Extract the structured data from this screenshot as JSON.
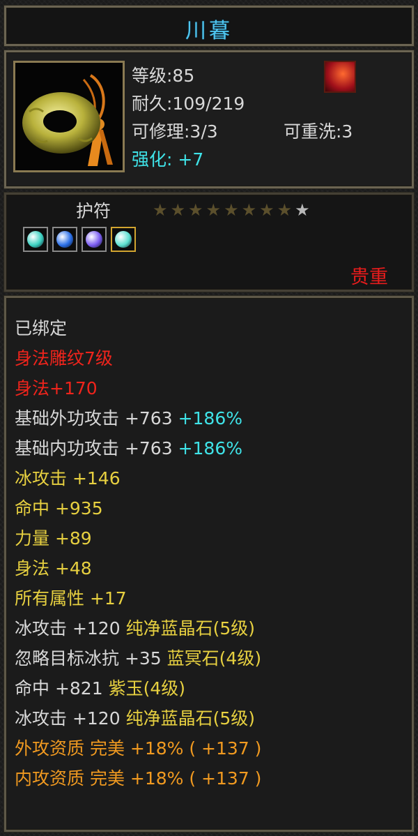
{
  "item": {
    "name": "川暮",
    "level_label": "等级:85",
    "durability_label": "耐久:109/219",
    "repair_label": "可修理:3/3",
    "rewash_label": "可重洗:3",
    "enhance_label": "强化:",
    "enhance_value": "+7",
    "type_label": "护符",
    "rarity_label": "贵重",
    "stars_total": 9,
    "stars_filled": 8,
    "gems": [
      {
        "icon": "teal-gem-icon",
        "color": "#3bd0c0"
      },
      {
        "icon": "blue-gem-icon",
        "color": "#2a6fe8"
      },
      {
        "icon": "purple-gem-icon",
        "color": "#7a5cf0"
      },
      {
        "icon": "teal-gem-icon",
        "color": "#5ce0d0"
      }
    ]
  },
  "attributes": [
    {
      "parts": [
        {
          "text": "已绑定",
          "color": "white"
        }
      ]
    },
    {
      "parts": [
        {
          "text": "身法雕纹7级",
          "color": "red"
        }
      ]
    },
    {
      "parts": [
        {
          "text": "身法+170",
          "color": "red"
        }
      ]
    },
    {
      "parts": [
        {
          "text": "基础外功攻击  +763 ",
          "color": "white"
        },
        {
          "text": "+186%",
          "color": "cyan"
        }
      ]
    },
    {
      "parts": [
        {
          "text": "基础内功攻击  +763 ",
          "color": "white"
        },
        {
          "text": "+186%",
          "color": "cyan"
        }
      ]
    },
    {
      "parts": [
        {
          "text": "冰攻击  +146",
          "color": "yellow"
        }
      ]
    },
    {
      "parts": [
        {
          "text": "命中  +935",
          "color": "yellow"
        }
      ]
    },
    {
      "parts": [
        {
          "text": "力量  +89",
          "color": "yellow"
        }
      ]
    },
    {
      "parts": [
        {
          "text": "身法  +48",
          "color": "yellow"
        }
      ]
    },
    {
      "parts": [
        {
          "text": "所有属性  +17",
          "color": "yellow"
        }
      ]
    },
    {
      "parts": [
        {
          "text": "冰攻击  +120  ",
          "color": "white"
        },
        {
          "text": "纯净蓝晶石(5级)",
          "color": "yellow"
        }
      ]
    },
    {
      "parts": [
        {
          "text": "忽略目标冰抗  +35  ",
          "color": "white"
        },
        {
          "text": "蓝冥石(4级)",
          "color": "yellow"
        }
      ]
    },
    {
      "parts": [
        {
          "text": "命中  +821  ",
          "color": "white"
        },
        {
          "text": "紫玉(4级)",
          "color": "yellow"
        }
      ]
    },
    {
      "parts": [
        {
          "text": "冰攻击  +120  ",
          "color": "white"
        },
        {
          "text": "纯净蓝晶石(5级)",
          "color": "yellow"
        }
      ]
    },
    {
      "parts": [
        {
          "text": "外攻资质    完美  +18% ( +137 )",
          "color": "orange"
        }
      ]
    },
    {
      "parts": [
        {
          "text": "内攻资质    完美  +18% ( +137 )",
          "color": "orange"
        }
      ]
    }
  ]
}
